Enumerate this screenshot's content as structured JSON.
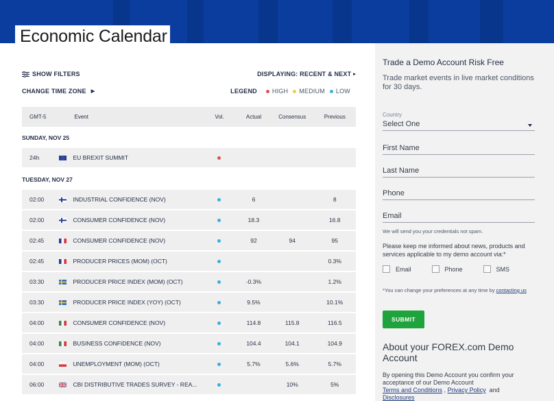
{
  "page": {
    "title": "Economic Calendar"
  },
  "controls": {
    "show_filters": "SHOW FILTERS",
    "displaying": "DISPLAYING: RECENT & NEXT",
    "change_time_zone": "CHANGE TIME ZONE",
    "legend_label": "LEGEND",
    "legend": [
      {
        "label": "HIGH",
        "color": "#d9534f"
      },
      {
        "label": "MEDIUM",
        "color": "#f2c94c"
      },
      {
        "label": "LOW",
        "color": "#3aaee0"
      }
    ]
  },
  "table": {
    "headers": {
      "time": "GMT-5",
      "event": "Event",
      "vol": "Vol.",
      "actual": "Actual",
      "consensus": "Consensus",
      "previous": "Previous"
    },
    "days": [
      {
        "label": "SUNDAY, NOV 25",
        "rows": [
          {
            "time": "24h",
            "flag": "eu",
            "event": "EU BREXIT SUMMIT",
            "vol": "high",
            "actual": "",
            "consensus": "",
            "previous": ""
          }
        ]
      },
      {
        "label": "TUESDAY, NOV 27",
        "rows": [
          {
            "time": "02:00",
            "flag": "fi",
            "event": "INDUSTRIAL CONFIDENCE (NOV)",
            "vol": "low",
            "actual": "6",
            "consensus": "",
            "previous": "8"
          },
          {
            "time": "02:00",
            "flag": "fi",
            "event": "CONSUMER CONFIDENCE (NOV)",
            "vol": "low",
            "actual": "18.3",
            "consensus": "",
            "previous": "16.8"
          },
          {
            "time": "02:45",
            "flag": "fr",
            "event": "CONSUMER CONFIDENCE (NOV)",
            "vol": "low",
            "actual": "92",
            "consensus": "94",
            "previous": "95"
          },
          {
            "time": "02:45",
            "flag": "fr",
            "event": "PRODUCER PRICES (MOM) (OCT)",
            "vol": "low",
            "actual": "",
            "consensus": "",
            "previous": "0.3%"
          },
          {
            "time": "03:30",
            "flag": "se",
            "event": "PRODUCER PRICE INDEX (MOM) (OCT)",
            "vol": "low",
            "actual": "-0.3%",
            "consensus": "",
            "previous": "1.2%"
          },
          {
            "time": "03:30",
            "flag": "se",
            "event": "PRODUCER PRICE INDEX (YOY) (OCT)",
            "vol": "low",
            "actual": "9.5%",
            "consensus": "",
            "previous": "10.1%"
          },
          {
            "time": "04:00",
            "flag": "it",
            "event": "CONSUMER CONFIDENCE (NOV)",
            "vol": "low",
            "actual": "114.8",
            "consensus": "115.8",
            "previous": "116.5"
          },
          {
            "time": "04:00",
            "flag": "it",
            "event": "BUSINESS CONFIDENCE (NOV)",
            "vol": "low",
            "actual": "104.4",
            "consensus": "104.1",
            "previous": "104.9"
          },
          {
            "time": "04:00",
            "flag": "pl",
            "event": "UNEMPLOYMENT (MOM) (OCT)",
            "vol": "low",
            "actual": "5.7%",
            "consensus": "5.6%",
            "previous": "5.7%"
          },
          {
            "time": "06:00",
            "flag": "gb",
            "event": "CBI DISTRIBUTIVE TRADES SURVEY - REA...",
            "vol": "low",
            "actual": "",
            "consensus": "10%",
            "previous": "5%"
          }
        ]
      }
    ]
  },
  "demo": {
    "title": "Trade a Demo Account Risk Free",
    "subtitle": "Trade market events in live market conditions for 30 days.",
    "country_label": "Country",
    "country_value": "Select One",
    "first_name": "First Name",
    "last_name": "Last Name",
    "phone": "Phone",
    "email": "Email",
    "spam_note": "We will send you your credentials not spam.",
    "keep_informed": "Please keep me informed about news, products and services applicable to my demo account via:*",
    "checks": [
      "Email",
      "Phone",
      "SMS"
    ],
    "change_prefix": "*You can change your preferences at any time by ",
    "change_link": "contacting us",
    "submit": "SUBMIT",
    "about": "About your FOREX.com Demo Account",
    "open_text": "By opening this Demo Account you confirm your acceptance of our Demo Account",
    "terms": "Terms and Conditions",
    "privacy": "Privacy Policy",
    "and": "and",
    "disclosures": "Disclosures"
  }
}
